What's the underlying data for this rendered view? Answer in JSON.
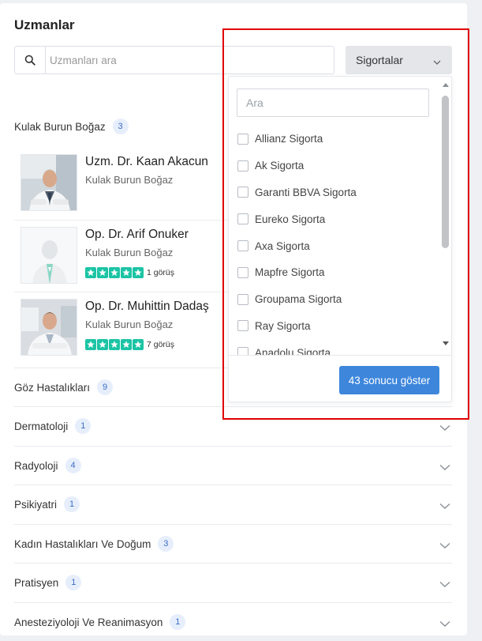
{
  "page": {
    "title": "Uzmanlar"
  },
  "search": {
    "placeholder": "Uzmanları ara",
    "icon": "search-icon"
  },
  "insurance_button": {
    "label": "Sigortalar",
    "icon": "chevron-down-icon"
  },
  "active_category": {
    "name": "Kulak Burun Boğaz",
    "count": "3",
    "doctors": [
      {
        "name": "Uzm. Dr. Kaan Akacun",
        "specialty": "Kulak Burun Boğaz",
        "stars": 0,
        "reviews": ""
      },
      {
        "name": "Op. Dr. Arif Onuker",
        "specialty": "Kulak Burun Boğaz",
        "stars": 5,
        "reviews": "1 görüş"
      },
      {
        "name": "Op. Dr. Muhittin Dadaş",
        "specialty": "Kulak Burun Boğaz",
        "stars": 5,
        "reviews": "7 görüş"
      }
    ]
  },
  "categories": [
    {
      "name": "Göz Hastalıkları",
      "count": "9"
    },
    {
      "name": "Dermatoloji",
      "count": "1"
    },
    {
      "name": "Radyoloji",
      "count": "4"
    },
    {
      "name": "Psikiyatri",
      "count": "1"
    },
    {
      "name": "Kadın Hastalıkları Ve Doğum",
      "count": "3"
    },
    {
      "name": "Pratisyen",
      "count": "1"
    },
    {
      "name": "Anesteziyoloji Ve Reanimasyon",
      "count": "1"
    }
  ],
  "dropdown": {
    "search_placeholder": "Ara",
    "options": [
      "Allianz Sigorta",
      "Ak Sigorta",
      "Garanti BBVA Sigorta",
      "Eureko Sigorta",
      "Axa Sigorta",
      "Mapfre Sigorta",
      "Groupama Sigorta",
      "Ray Sigorta",
      "Anadolu Sigorta"
    ],
    "show_results_label": "43 sonucu göster"
  },
  "colors": {
    "accent": "#3d86dc",
    "star": "#1bc4a4",
    "highlight": "#e00000",
    "badge_bg": "#e7eefb"
  }
}
